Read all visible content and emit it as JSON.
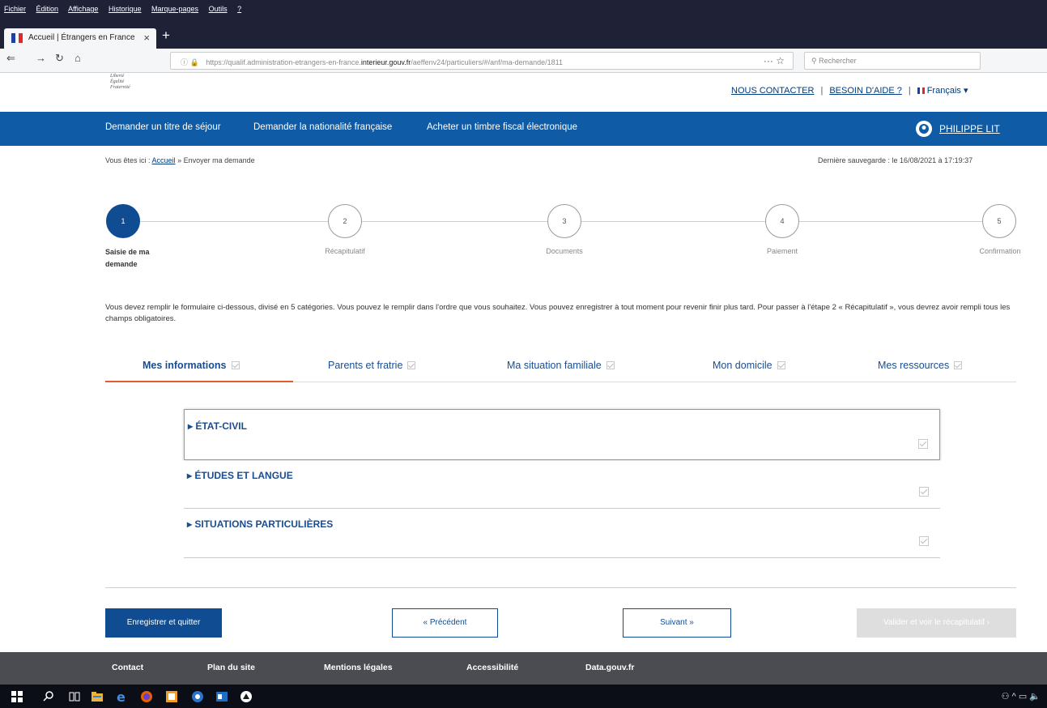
{
  "browser": {
    "menu": [
      "Fichier",
      "Édition",
      "Affichage",
      "Historique",
      "Marque-pages",
      "Outils",
      "?"
    ],
    "tab_title": "Accueil | Étrangers en France",
    "url_prefix": "https://qualif.administration-etrangers-en-france.",
    "url_domain": "interieur.gouv.fr",
    "url_suffix": "/aeffenv24/particuliers/#/anf/ma-demande/1811",
    "search_placeholder": "Rechercher"
  },
  "header": {
    "motto": [
      "Liberté",
      "Égalité",
      "Fraternité"
    ],
    "contact": "NOUS CONTACTER",
    "help": "BESOIN D'AIDE ?",
    "language": "Français",
    "nav": [
      "Demander un titre de séjour",
      "Demander la nationalité française",
      "Acheter un timbre fiscal électronique"
    ],
    "user": "PHILIPPE LIT"
  },
  "breadcrumb": {
    "prefix": "Vous êtes ici :",
    "home": "Accueil",
    "current": "» Envoyer ma demande"
  },
  "last_save": "Dernière sauvegarde : le 16/08/2021 à 17:19:37",
  "steps": [
    {
      "number": "1",
      "label": "Saisie de ma demande"
    },
    {
      "number": "2",
      "label": "Récapitulatif"
    },
    {
      "number": "3",
      "label": "Documents"
    },
    {
      "number": "4",
      "label": "Paiement"
    },
    {
      "number": "5",
      "label": "Confirmation"
    }
  ],
  "intro": "Vous devez remplir le formulaire ci-dessous, divisé en 5 catégories. Vous pouvez le remplir dans l'ordre que vous souhaitez. Vous pouvez enregistrer à tout moment pour revenir finir plus tard. Pour passer à l'étape 2 « Récapitulatif », vous devrez avoir rempli tous les champs obligatoires.",
  "categories": [
    "Mes informations",
    "Parents et fratrie",
    "Ma situation familiale",
    "Mon domicile",
    "Mes ressources"
  ],
  "sections": [
    "ÉTAT-CIVIL",
    "ÉTUDES ET LANGUE",
    "SITUATIONS PARTICULIÈRES"
  ],
  "buttons": {
    "save_quit": "Enregistrer et quitter",
    "previous": "« Précédent",
    "next": "Suivant »",
    "validate": "Valider et voir le récapitulatif ›"
  },
  "footer": [
    "Contact",
    "Plan du site",
    "Mentions légales",
    "Accessibilité",
    "Data.gouv.fr"
  ],
  "colors": {
    "primary": "#0f4c91",
    "nav_bar": "#0f5ba6",
    "active_tab_underline": "#e35d2c",
    "footer": "#4a4c52"
  }
}
